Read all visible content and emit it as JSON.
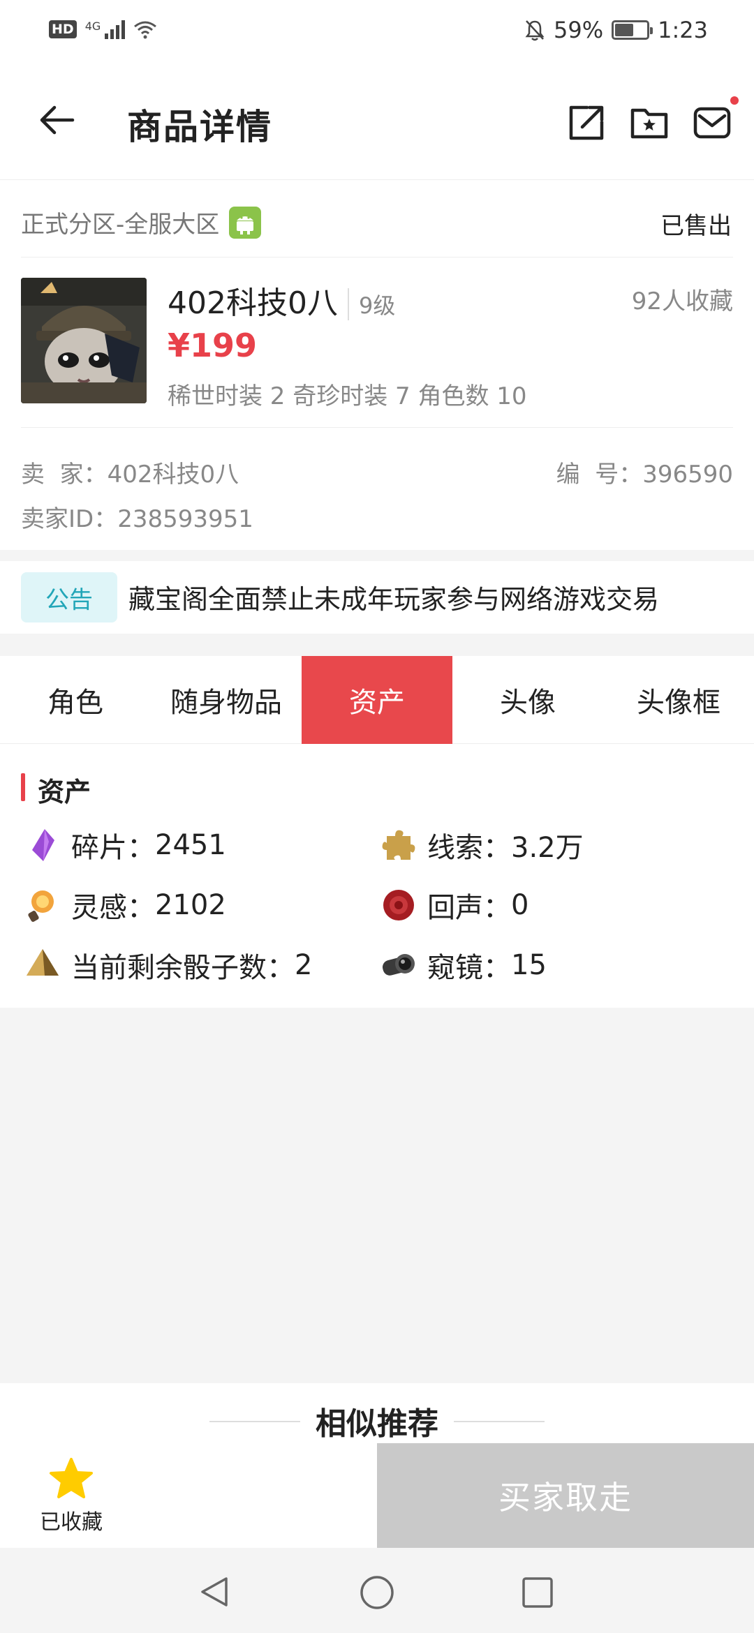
{
  "status_bar": {
    "hd_label": "HD",
    "network_label": "4G",
    "battery_percent": "59%",
    "battery_level": 0.59,
    "time": "1:23"
  },
  "header": {
    "title": "商品详情",
    "icons": [
      "back-arrow-icon",
      "share-icon",
      "favorite-folder-icon",
      "mail-icon"
    ],
    "has_notification_dot": true
  },
  "listing": {
    "zone": "正式分区-全服大区",
    "platform_icon": "android-icon",
    "status": "已售出",
    "name": "402科技0八",
    "level": "9级",
    "favorites": "92人收藏",
    "price": "¥199",
    "summary": "稀世时装 2 奇珍时装 7 角色数 10",
    "seller": "卖  家：402科技0八",
    "serial": "编  号：396590",
    "seller_id": "卖家ID：238593951"
  },
  "notice": {
    "tag": "公告",
    "text": "藏宝阁全面禁止未成年玩家参与网络游戏交易"
  },
  "tabs": [
    {
      "label": "角色",
      "active": false
    },
    {
      "label": "随身物品",
      "active": false
    },
    {
      "label": "资产",
      "active": true
    },
    {
      "label": "头像",
      "active": false
    },
    {
      "label": "头像框",
      "active": false
    }
  ],
  "assets": {
    "section_title": "资产",
    "items": [
      {
        "label": "碎片：",
        "value": "2451",
        "icon": "shard-icon"
      },
      {
        "label": "线索：",
        "value": "3.2万",
        "icon": "puzzle-icon"
      },
      {
        "label": "灵感：",
        "value": "2102",
        "icon": "inspiration-icon"
      },
      {
        "label": "回声：",
        "value": "0",
        "icon": "echo-icon"
      },
      {
        "label": "当前剩余骰子数：",
        "value": "2",
        "icon": "dice-icon"
      },
      {
        "label": "窥镜：",
        "value": "15",
        "icon": "telescope-icon"
      }
    ]
  },
  "similar": {
    "title": "相似推荐"
  },
  "bottom_bar": {
    "collect_label": "已收藏",
    "buy_label": "买家取走"
  },
  "colors": {
    "accent_red": "#e8414a",
    "notice_teal": "#22a6b8",
    "disabled_gray": "#c9c9c9",
    "star_yellow": "#ffcc00"
  }
}
